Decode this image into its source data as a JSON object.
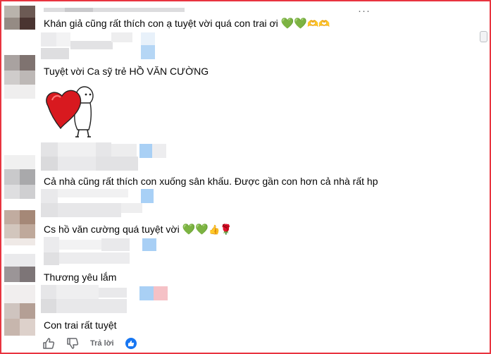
{
  "comments": [
    {
      "text": "Khán giả cũng rất thích con ạ tuyệt vời quá con trai ơi",
      "emojis": [
        "💚",
        "💚",
        "🫶",
        "🫶"
      ]
    },
    {
      "text": "Tuyệt vời Ca sỹ trẻ HỒ VĂN CƯỜNG",
      "emojis": []
    },
    {
      "text": "Cả nhà cũng rất thích con xuống sân khấu. Được gần con hơn cả nhà rất hp",
      "emojis": []
    },
    {
      "text": "Cs hồ văn cường quá tuyệt vời",
      "emojis": [
        "💚",
        "💚",
        "👍",
        "🌹"
      ]
    },
    {
      "text": "Thương yêu lắm",
      "emojis": []
    },
    {
      "text": "Con trai rất tuyệt",
      "emojis": []
    }
  ],
  "actions": {
    "like_icon": "thumbs-up-icon",
    "dislike_icon": "thumbs-down-icon",
    "reply_label": "Trả lời",
    "reaction_icon": "like-reaction-icon"
  },
  "menu": {
    "more_label": "···"
  },
  "colors": {
    "border": "#e8343f",
    "like_blue": "#1877f2",
    "heart_green": "#4caf2a",
    "muted": "#65676b"
  }
}
